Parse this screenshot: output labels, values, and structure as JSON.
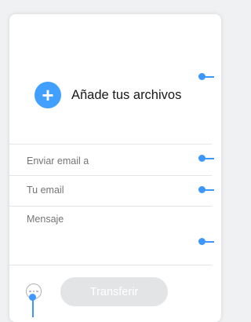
{
  "upload": {
    "label": "Añade tus archivos",
    "icon": "plus-icon"
  },
  "form": {
    "email_to_placeholder": "Enviar email a",
    "your_email_placeholder": "Tu email",
    "message_placeholder": "Mensaje"
  },
  "footer": {
    "transfer_label": "Transferir",
    "options_icon": "more-options-icon"
  },
  "colors": {
    "accent": "#409fff",
    "callout": "#3d97ff",
    "disabled_button": "#e3e4e6"
  }
}
